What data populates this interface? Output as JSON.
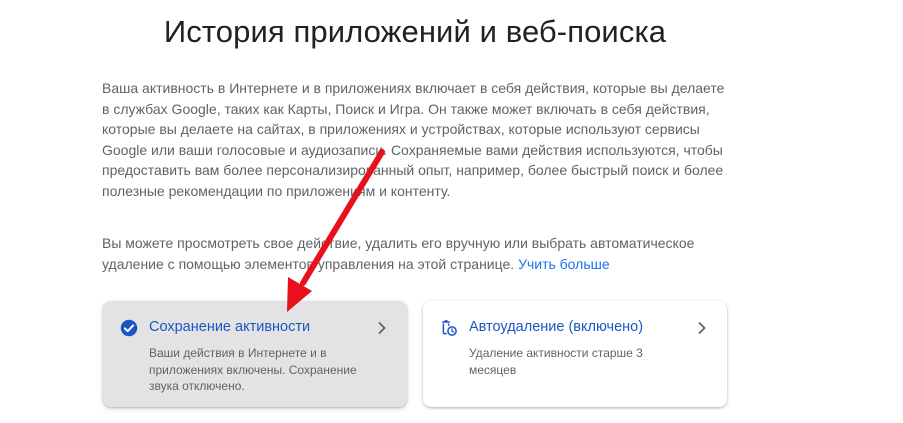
{
  "page": {
    "title": "История приложений и веб-поиска",
    "description": "Ваша активность в Интернете и в приложениях включает в себя действия, которые вы делаете в службах Google, таких как Карты, Поиск и Игра. Он также может включать в себя действия, которые вы делаете на сайтах, в приложениях и устройствах, которые используют сервисы Google или ваши голосовые и аудиозаписи. Сохраняемые вами действия используются, чтобы предоставить вам более персонализированный опыт, например, более быстрый поиск и более полезные рекомендации по приложениям и контенту.",
    "description2": "Вы можете просмотреть свое действие, удалить его вручную или выбрать автоматическое удаление с помощью элементов управления на этой странице.",
    "learn_more": "Учить больше"
  },
  "cards": {
    "activity": {
      "title": "Сохранение активности",
      "subtitle": "Ваши действия в Интернете и в приложениях включены. Сохранение звука отключено.",
      "icon": "check-circle-icon"
    },
    "autodelete": {
      "title": "Автоудаление (включено)",
      "subtitle": "Удаление активности старше 3 месяцев",
      "icon": "auto-delete-icon"
    }
  },
  "colors": {
    "accent": "#1a73e8",
    "annotation_arrow": "#e8101a"
  }
}
